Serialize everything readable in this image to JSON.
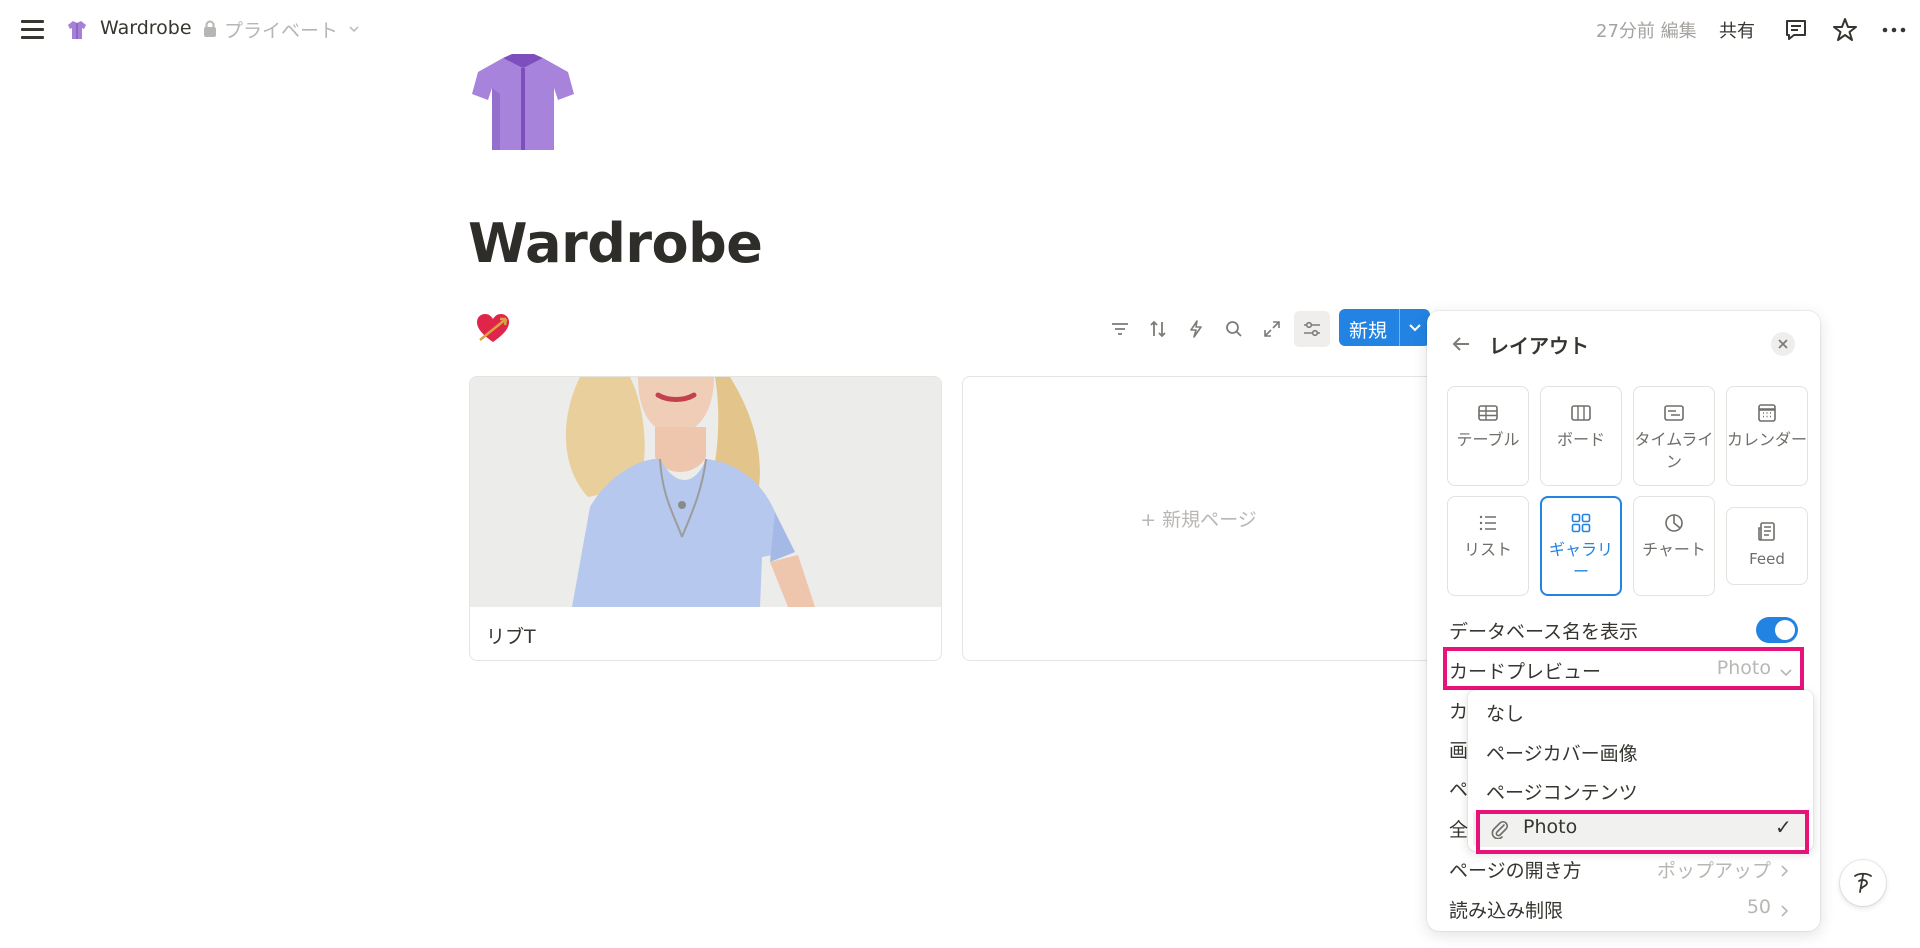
{
  "topbar": {
    "title": "Wardrobe",
    "privacy": "プライベート",
    "edited": "27分前 編集",
    "share": "共有",
    "icons": [
      "menu-icon",
      "shirt-icon",
      "lock-icon",
      "chevron-down-icon",
      "comment-icon",
      "star-icon",
      "more-icon"
    ]
  },
  "page": {
    "title": "Wardrobe",
    "icon": "shirt-icon"
  },
  "toolbar": {
    "db_icon": "heart-arrow-icon",
    "icons": [
      "filter-icon",
      "sort-icon",
      "automation-icon",
      "search-icon",
      "expand-icon",
      "settings-sliders-icon"
    ],
    "new_label": "新規"
  },
  "gallery": {
    "cards": [
      {
        "title": "リブT",
        "image": "photo-blue-tshirt"
      }
    ],
    "new_page_label": "+ 新規ページ"
  },
  "panel": {
    "title": "レイアウト",
    "layouts": [
      {
        "label": "テーブル",
        "icon": "table-icon"
      },
      {
        "label": "ボード",
        "icon": "board-icon"
      },
      {
        "label": "タイムライン",
        "icon": "timeline-icon"
      },
      {
        "label": "カレンダー",
        "icon": "calendar-icon"
      },
      {
        "label": "リスト",
        "icon": "list-icon"
      },
      {
        "label": "ギャラリー",
        "icon": "gallery-icon",
        "selected": true
      },
      {
        "label": "チャート",
        "icon": "chart-icon"
      },
      {
        "label": "Feed",
        "icon": "feed-icon"
      }
    ],
    "show_db_name_label": "データベース名を表示",
    "show_db_name_on": true,
    "card_preview_label": "カードプレビュー",
    "card_preview_value": "Photo",
    "hidden_rows_partial": [
      "カ",
      "画",
      "ペ",
      "全"
    ],
    "open_pages_label": "ページの開き方",
    "open_pages_value": "ポップアップ",
    "load_limit_label": "読み込み制限",
    "load_limit_value": "50"
  },
  "dropdown": {
    "options": [
      {
        "label": "なし"
      },
      {
        "label": "ページカバー画像"
      },
      {
        "label": "ページコンテンツ"
      },
      {
        "label": "Photo",
        "icon": "paperclip-icon",
        "checked": true
      }
    ],
    "check": "✓"
  },
  "colors": {
    "accent": "#2383e2",
    "highlight": "#e8137a",
    "text": "#37352f",
    "muted": "#b9b7b3"
  }
}
